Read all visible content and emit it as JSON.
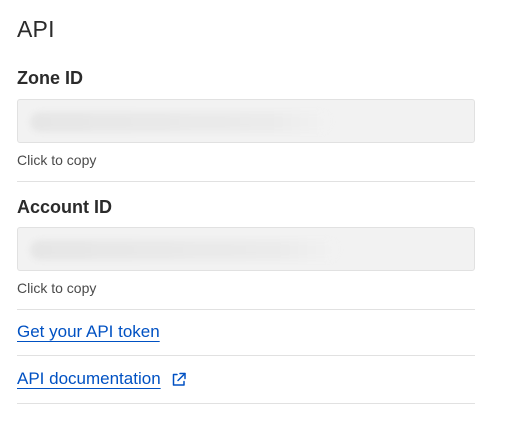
{
  "section": {
    "title": "API"
  },
  "zone": {
    "label": "Zone ID",
    "value": "",
    "hint": "Click to copy"
  },
  "account": {
    "label": "Account ID",
    "value": "",
    "hint": "Click to copy"
  },
  "links": {
    "api_token": "Get your API token",
    "api_docs": "API documentation"
  },
  "colors": {
    "link": "#0051c3",
    "field_bg": "#f2f2f2",
    "divider": "#e1e1e1"
  },
  "icons": {
    "external_link": "external-link-icon"
  }
}
